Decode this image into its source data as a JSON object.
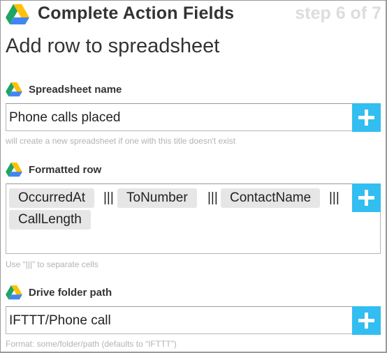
{
  "header": {
    "title": "Complete Action Fields",
    "step": "step 6 of 7"
  },
  "action": {
    "title": "Add row to spreadsheet"
  },
  "fields": {
    "spreadsheet_name": {
      "label": "Spreadsheet name",
      "value": "Phone calls placed",
      "hint": "will create a new spreadsheet if one with this title doesn't exist"
    },
    "formatted_row": {
      "label": "Formatted row",
      "tokens": [
        "OccurredAt",
        "ToNumber",
        "ContactName",
        "CallLength"
      ],
      "separator": "|||",
      "hint": "Use “|||” to separate cells"
    },
    "drive_folder_path": {
      "label": "Drive folder path",
      "value": "IFTTT/Phone call",
      "hint": "Format: some/folder/path (defaults to “IFTTT”)"
    }
  },
  "colors": {
    "accent": "#32bef0",
    "token_bg": "#e6e6e6",
    "hint_text": "#b3b3b3",
    "step_text": "#dddddd"
  },
  "icons": [
    "google-drive-icon",
    "plus-icon"
  ]
}
